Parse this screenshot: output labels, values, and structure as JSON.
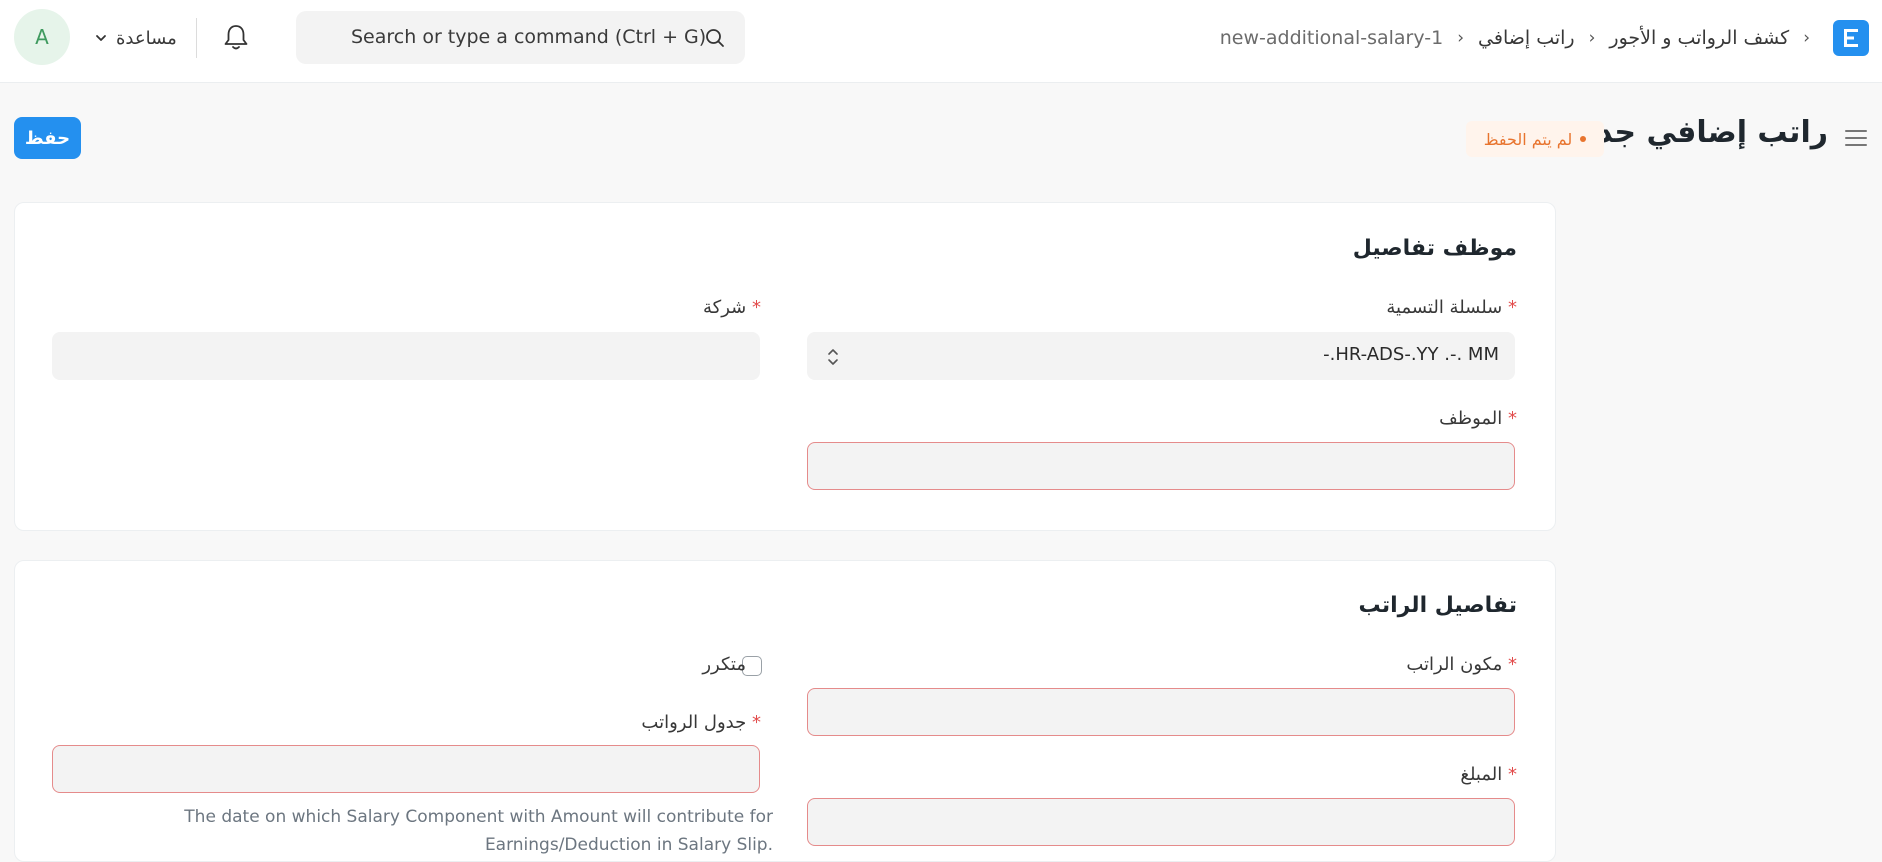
{
  "navbar": {
    "logo_letter": "E",
    "breadcrumbs": [
      "كشف الرواتب و الأجور",
      "راتب إضافي",
      "new-additional-salary-1"
    ],
    "search_placeholder": "Search or type a command (Ctrl + G)",
    "help_label": "مساعدة",
    "avatar_initial": "A"
  },
  "page": {
    "title": "راتب إضافي جديد",
    "status": "لم يتم الحفظ",
    "save_label": "حفظ"
  },
  "sections": {
    "employee_details": {
      "title": "موظف تفاصيل",
      "naming_series_label": "سلسلة التسمية",
      "naming_series_value": "-.HR-ADS-.YY .-. MM",
      "company_label": "شركة",
      "employee_label": "الموظف",
      "required_mark": "*"
    },
    "salary_details": {
      "title": "تفاصيل الراتب",
      "salary_component_label": "مكون الراتب",
      "recurring_label": "متكرر",
      "recurring_checked": false,
      "payroll_date_label": "جدول الرواتب",
      "amount_label": "المبلغ",
      "payroll_date_description": "The date on which Salary Component with Amount will contribute for Earnings/Deduction in Salary Slip."
    }
  },
  "colors": {
    "primary": "#2490ef",
    "status_orange": "#e8742e",
    "required_red": "#e24c4c",
    "avatar_bg": "#e6f4ea",
    "avatar_fg": "#3f9a5f"
  },
  "icons": [
    "logo-icon",
    "search-icon",
    "bell-icon",
    "chevron-down-icon",
    "hamburger-icon",
    "select-chevron-icon",
    "checkbox"
  ]
}
